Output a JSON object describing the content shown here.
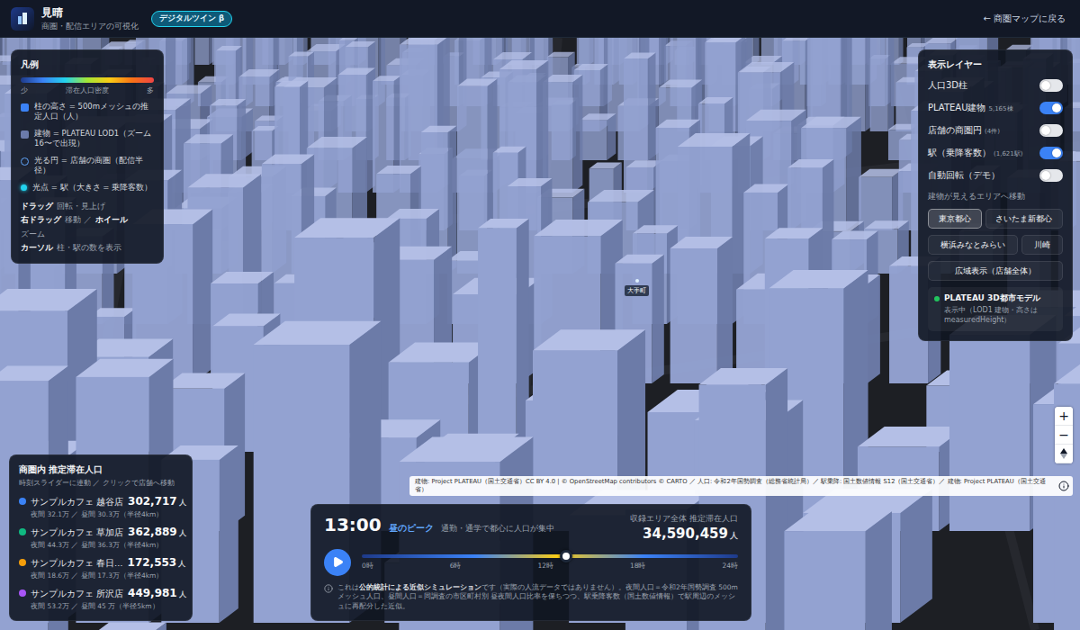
{
  "header": {
    "title": "見晴",
    "subtitle": "商圏・配信エリアの可視化",
    "badge": "デジタルツイン β",
    "back_link": "← 商圏マップに戻る"
  },
  "legend": {
    "title": "凡例",
    "scale_label": "滞在人口密度",
    "scale_min": "少",
    "scale_max": "多",
    "items": [
      {
        "kind": "column",
        "color": "#3b82f6",
        "text": "柱の高さ = 500mメッシュの推定人口（人）"
      },
      {
        "kind": "building",
        "color": "#6b7bab",
        "text": "建物 = PLATEAU LOD1（ズーム16〜で出現）"
      },
      {
        "kind": "ring",
        "color": "#60a5fa",
        "text": "光る円 = 店舗の商圏（配信半径）"
      },
      {
        "kind": "dot",
        "color": "#22d3ee",
        "text": "光点 = 駅（大きさ = 乗降客数）"
      }
    ],
    "help": [
      [
        {
          "text": "ドラッグ",
          "bold": true
        },
        {
          "text": "回転・見上げ",
          "bold": false
        }
      ],
      [
        {
          "text": "右ドラッグ",
          "bold": true
        },
        {
          "text": "移動 ／",
          "bold": false
        },
        {
          "text": "ホイール",
          "bold": true
        },
        {
          "text": "ズーム",
          "bold": false
        }
      ],
      [
        {
          "text": "カーソル",
          "bold": true
        },
        {
          "text": "柱・駅の数を表示",
          "bold": false
        }
      ]
    ]
  },
  "layers": {
    "title": "表示レイヤー",
    "items": [
      {
        "label": "人口3D柱",
        "on": false
      },
      {
        "label": "PLATEAU建物",
        "count": "5,165棟",
        "on": true
      },
      {
        "label": "店舗の商圏円",
        "count": "(4件)",
        "on": false
      },
      {
        "label": "駅（乗降客数）",
        "count": "(1,621駅)",
        "on": true
      },
      {
        "label": "自動回転（デモ）",
        "on": false
      }
    ]
  },
  "areas": {
    "title": "建物が見えるエリアへ移動",
    "buttons": [
      {
        "label": "東京都心",
        "selected": true
      },
      {
        "label": "さいたま新都心",
        "selected": false
      },
      {
        "label": "横浜みなとみらい",
        "selected": false
      },
      {
        "label": "川崎",
        "selected": false
      }
    ],
    "wide_button": {
      "label": "広域表示（店舗全体）",
      "selected": false
    }
  },
  "model_status": {
    "title": "PLATEAU 3D都市モデル",
    "detail": "表示中（LOD1 建物・高さは measuredHeight）",
    "color": "#22c55e"
  },
  "map": {
    "place_label": "大手町",
    "zoom_in": "+",
    "zoom_out": "−"
  },
  "attribution": "建物: Project PLATEAU（国土交通省）CC BY 4.0 | © OpenStreetMap contributors © CARTO ／ 人口: 令和2年国勢調査（総務省統計局）／ 駅乗降: 国土数値情報 S12（国土交通省）／ 建物: Project PLATEAU（国土交通省）",
  "stores": {
    "title": "商圏内 推定滞在人口",
    "subtitle": "時刻スライダーに連動 ／ クリックで店舗へ移動",
    "items": [
      {
        "name": "サンプルカフェ 越谷店",
        "color": "#3b82f6",
        "population": "302,717",
        "unit": "人",
        "detail": "夜間 32.1万 ／ 昼間 30.3万（半径4km）"
      },
      {
        "name": "サンプルカフェ 草加店",
        "color": "#10b981",
        "population": "362,889",
        "unit": "人",
        "detail": "夜間 44.3万 ／ 昼間 36.3万（半径4km）"
      },
      {
        "name": "サンプルカフェ 春日…",
        "color": "#f59e0b",
        "population": "172,553",
        "unit": "人",
        "detail": "夜間 18.6万 ／ 昼間 17.3万（半径4km）"
      },
      {
        "name": "サンプルカフェ 所沢店",
        "color": "#a855f7",
        "population": "449,981",
        "unit": "人",
        "detail": "夜間 53.2万 ／ 昼間 45 万（半径5km）"
      }
    ]
  },
  "timeline": {
    "time": "13:00",
    "phase": "昼のピーク",
    "description": "通勤・通学で都心に人口が集中",
    "total_label": "収録エリア全体 推定滞在人口",
    "total": "34,590,459",
    "unit": "人",
    "level": 0.542,
    "ticks": [
      "0時",
      "6時",
      "12時",
      "18時",
      "24時"
    ],
    "note": [
      {
        "text": "これは",
        "bold": false
      },
      {
        "text": "公的統計による近似シミュレーション",
        "bold": true
      },
      {
        "text": "です（実際の人流データではありません）。夜間人口＝令和2年国勢調査 500mメッシュ人口、昼間人口＝同調査の市区町村別 昼夜間人口比率を保ちつつ、駅乗降客数（国土数値情報）で駅周辺のメッシュに再配分した近似。",
        "bold": false
      }
    ]
  }
}
